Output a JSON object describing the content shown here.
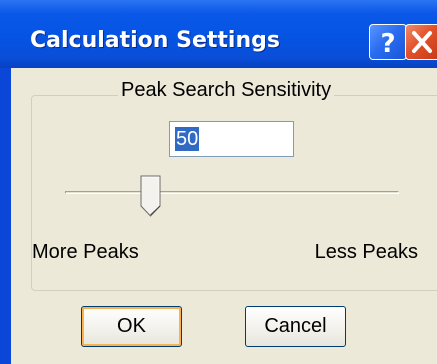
{
  "window": {
    "title": "Calculation Settings"
  },
  "titlebar_buttons": {
    "help_icon": "question-mark-icon",
    "close_icon": "close-x-icon"
  },
  "group": {
    "label": "Peak Search Sensitivity"
  },
  "sensitivity": {
    "value": "50"
  },
  "slider": {
    "left_label": "More Peaks",
    "right_label": "Less Peaks",
    "position_fraction": 0.25
  },
  "buttons": {
    "ok_label": "OK",
    "cancel_label": "Cancel"
  },
  "colors": {
    "titlebar": "#0554e3",
    "client_bg": "#ece9d8",
    "close_button": "#e2532d",
    "selection": "#316ac5"
  }
}
